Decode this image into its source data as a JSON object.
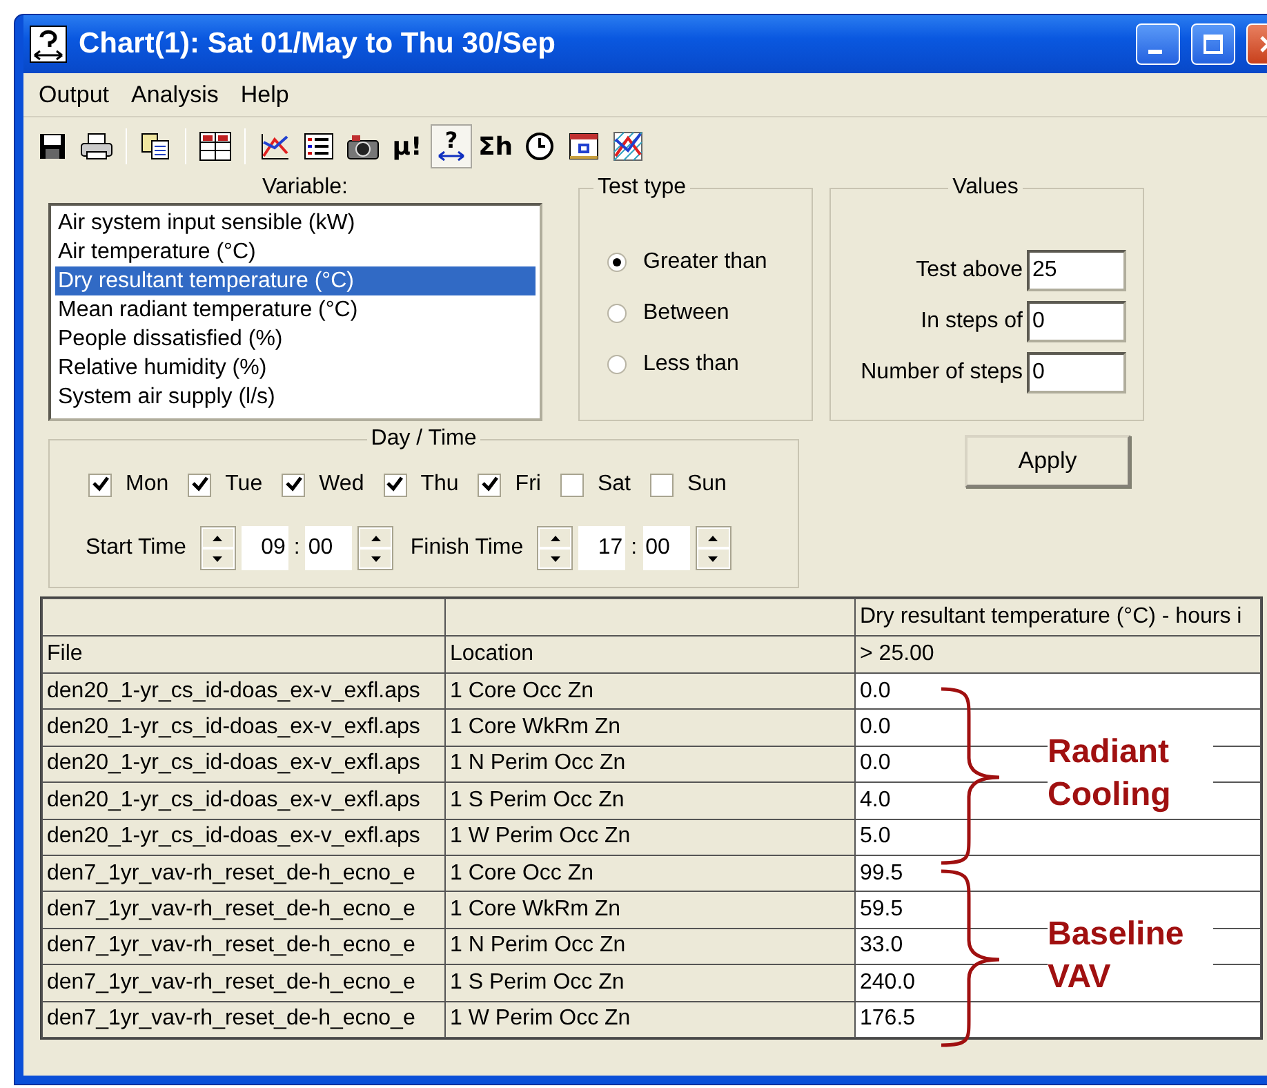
{
  "window": {
    "title": "Chart(1): Sat 01/May to Thu 30/Sep"
  },
  "menu": [
    {
      "label": "Output"
    },
    {
      "label": "Analysis"
    },
    {
      "label": "Help"
    }
  ],
  "toolbar": [
    {
      "kind": "save",
      "pressed": false
    },
    {
      "kind": "print",
      "pressed": false
    },
    {
      "kind": "divider"
    },
    {
      "kind": "copy",
      "pressed": false
    },
    {
      "kind": "divider"
    },
    {
      "kind": "grid",
      "pressed": false
    },
    {
      "kind": "divider"
    },
    {
      "kind": "chart",
      "pressed": false
    },
    {
      "kind": "list",
      "pressed": false
    },
    {
      "kind": "camera",
      "pressed": false
    },
    {
      "kind": "glyph",
      "label": "µ!",
      "pressed": false
    },
    {
      "kind": "help",
      "label": "?",
      "pressed": true
    },
    {
      "kind": "glyph",
      "label": "Σh",
      "pressed": false
    },
    {
      "kind": "clock",
      "pressed": false
    },
    {
      "kind": "window",
      "pressed": false
    },
    {
      "kind": "hatch",
      "pressed": false
    }
  ],
  "variable": {
    "label": "Variable:",
    "items": [
      {
        "label": "Air system input sensible (kW)",
        "selected": false
      },
      {
        "label": "Air temperature (°C)",
        "selected": false
      },
      {
        "label": "Dry resultant temperature (°C)",
        "selected": true
      },
      {
        "label": "Mean radiant temperature (°C)",
        "selected": false
      },
      {
        "label": "People dissatisfied (%)",
        "selected": false
      },
      {
        "label": "Relative humidity (%)",
        "selected": false
      },
      {
        "label": "System air supply (l/s)",
        "selected": false
      }
    ]
  },
  "test_type": {
    "title": "Test type",
    "options": [
      {
        "label": "Greater than",
        "selected": true
      },
      {
        "label": "Between",
        "selected": false
      },
      {
        "label": "Less than",
        "selected": false
      }
    ]
  },
  "values": {
    "title": "Values",
    "fields": [
      {
        "label": "Test above",
        "value": "25"
      },
      {
        "label": "In steps of",
        "value": "0"
      },
      {
        "label": "Number of steps",
        "value": "0"
      }
    ]
  },
  "apply_button": "Apply",
  "day_time": {
    "title": "Day / Time",
    "days": [
      {
        "label": "Mon",
        "checked": true
      },
      {
        "label": "Tue",
        "checked": true
      },
      {
        "label": "Wed",
        "checked": true
      },
      {
        "label": "Thu",
        "checked": true
      },
      {
        "label": "Fri",
        "checked": true
      },
      {
        "label": "Sat",
        "checked": false
      },
      {
        "label": "Sun",
        "checked": false
      }
    ],
    "times": [
      {
        "label": "Start Time",
        "hours": "09",
        "separator": ":",
        "minutes": "00"
      },
      {
        "label": "Finish Time",
        "hours": "17",
        "separator": ":",
        "minutes": "00"
      }
    ]
  },
  "table": {
    "group_header": "Dry resultant temperature (°C) - hours i",
    "columns": [
      "File",
      "Location",
      "> 25.00"
    ],
    "rows": [
      [
        "den20_1-yr_cs_id-doas_ex-v_exfl.aps",
        "1 Core Occ Zn",
        "0.0"
      ],
      [
        "den20_1-yr_cs_id-doas_ex-v_exfl.aps",
        "1 Core WkRm Zn",
        "0.0"
      ],
      [
        "den20_1-yr_cs_id-doas_ex-v_exfl.aps",
        "1 N Perim Occ Zn",
        "0.0"
      ],
      [
        "den20_1-yr_cs_id-doas_ex-v_exfl.aps",
        "1 S Perim Occ Zn",
        "4.0"
      ],
      [
        "den20_1-yr_cs_id-doas_ex-v_exfl.aps",
        "1 W Perim Occ Zn",
        "5.0"
      ],
      [
        "den7_1yr_vav-rh_reset_de-h_ecno_e",
        "1 Core Occ Zn",
        "99.5"
      ],
      [
        "den7_1yr_vav-rh_reset_de-h_ecno_e",
        "1 Core WkRm Zn",
        "59.5"
      ],
      [
        "den7_1yr_vav-rh_reset_de-h_ecno_e",
        "1 N Perim Occ Zn",
        "33.0"
      ],
      [
        "den7_1yr_vav-rh_reset_de-h_ecno_e",
        "1 S Perim Occ Zn",
        "240.0"
      ],
      [
        "den7_1yr_vav-rh_reset_de-h_ecno_e",
        "1 W Perim Occ Zn",
        "176.5"
      ]
    ]
  },
  "annotations": [
    {
      "label": "Radiant Cooling"
    },
    {
      "label": "Baseline VAV"
    }
  ]
}
